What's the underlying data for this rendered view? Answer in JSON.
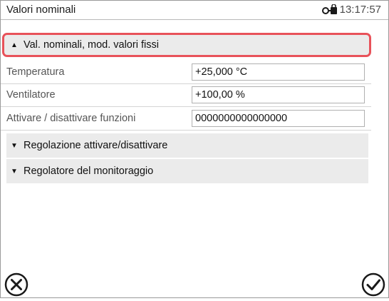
{
  "titlebar": {
    "title": "Valori nominali",
    "time": "13:17:57",
    "status_icon": "key-lock-icon"
  },
  "sections": {
    "nominal": "Val. nominali, mod. valori fissi",
    "regulation": "Regolazione attivare/disattivare",
    "monitoring": "Regolatore del monitoraggio"
  },
  "params": {
    "temperature": {
      "label": "Temperatura",
      "value": "+25,000 °C"
    },
    "fan": {
      "label": "Ventilatore",
      "value": "+100,00 %"
    },
    "functions": {
      "label": "Attivare / disattivare funzioni",
      "value": "0000000000000000"
    }
  },
  "buttons": {
    "cancel_icon": "cancel-circle-icon",
    "confirm_icon": "checkmark-circle-icon"
  },
  "colors": {
    "highlight": "#e8525a",
    "section_bg": "#ebebeb"
  }
}
